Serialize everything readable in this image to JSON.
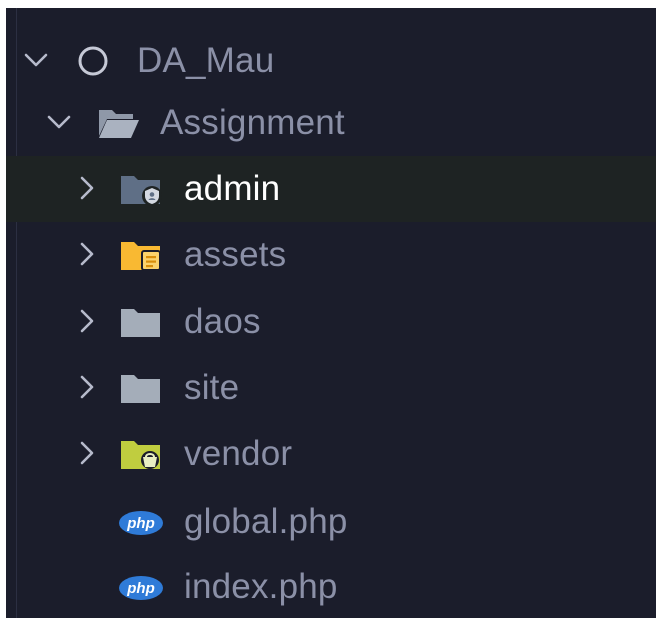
{
  "explorer": {
    "root": {
      "label": "DA_Mau",
      "icon": "circle-outline-icon",
      "expanded": true
    },
    "folder": {
      "label": "Assignment",
      "icon": "folder-open-icon",
      "expanded": true
    },
    "items": [
      {
        "label": "admin",
        "icon": "folder-admin-icon",
        "type": "folder",
        "expanded": false,
        "selected": true,
        "color": "#5f6f86"
      },
      {
        "label": "assets",
        "icon": "folder-assets-icon",
        "type": "folder",
        "expanded": false,
        "selected": false,
        "color": "#f9b932"
      },
      {
        "label": "daos",
        "icon": "folder-icon",
        "type": "folder",
        "expanded": false,
        "selected": false,
        "color": "#a4adb9"
      },
      {
        "label": "site",
        "icon": "folder-icon",
        "type": "folder",
        "expanded": false,
        "selected": false,
        "color": "#a4adb9"
      },
      {
        "label": "vendor",
        "icon": "folder-vendor-icon",
        "type": "folder",
        "expanded": false,
        "selected": false,
        "color": "#c0cd3f"
      },
      {
        "label": "global.php",
        "icon": "php-file-icon",
        "type": "file",
        "selected": false,
        "color": "#2f7bd8"
      },
      {
        "label": "index.php",
        "icon": "php-file-icon",
        "type": "file",
        "selected": false,
        "color": "#2f7bd8"
      }
    ],
    "php_badge_text": "php"
  },
  "colors": {
    "background": "#1b1d2b",
    "selected_row": "#1e2323",
    "text": "#8b90a7",
    "text_selected": "#ffffff",
    "chevron": "#b6bacb"
  }
}
